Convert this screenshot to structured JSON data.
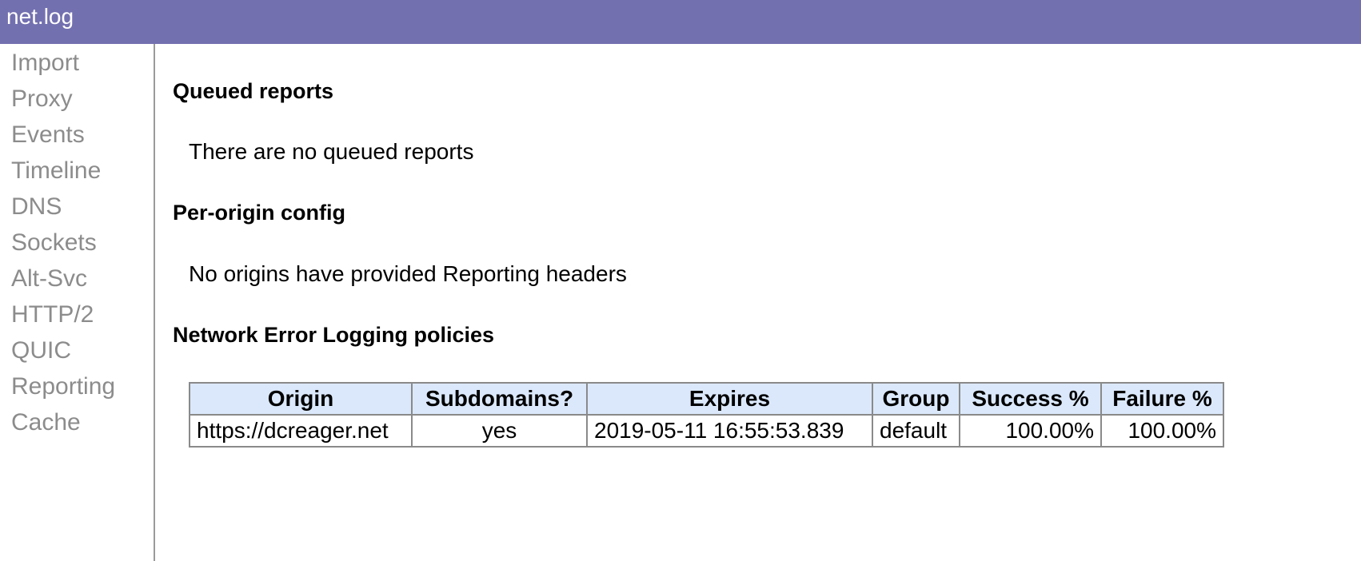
{
  "header": {
    "title": "net.log",
    "color": "#7370b0"
  },
  "sidebar": {
    "items": [
      {
        "label": "Import"
      },
      {
        "label": "Proxy"
      },
      {
        "label": "Events"
      },
      {
        "label": "Timeline"
      },
      {
        "label": "DNS"
      },
      {
        "label": "Sockets"
      },
      {
        "label": "Alt-Svc"
      },
      {
        "label": "HTTP/2"
      },
      {
        "label": "QUIC"
      },
      {
        "label": "Reporting"
      },
      {
        "label": "Cache"
      }
    ]
  },
  "main": {
    "queued": {
      "heading": "Queued reports",
      "text": "There are no queued reports"
    },
    "per_origin": {
      "heading": "Per-origin config",
      "text": "No origins have provided Reporting headers"
    },
    "nel": {
      "heading": "Network Error Logging policies",
      "columns": [
        "Origin",
        "Subdomains?",
        "Expires",
        "Group",
        "Success %",
        "Failure %"
      ],
      "rows": [
        [
          "https://dcreager.net",
          "yes",
          "2019-05-11 16:55:53.839",
          "default",
          "100.00%",
          "100.00%"
        ]
      ],
      "header_bg": "#dbe8fb"
    }
  }
}
